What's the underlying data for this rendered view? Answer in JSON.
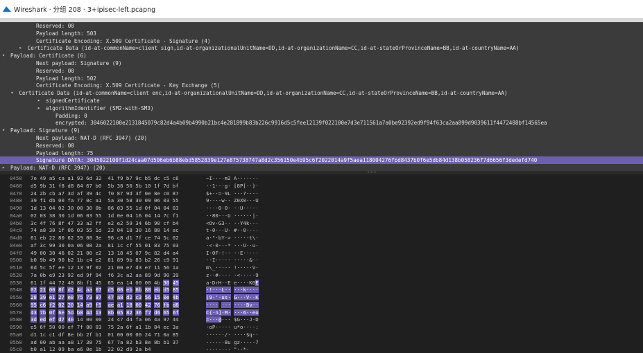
{
  "window": {
    "title": "Wireshark · 分组 208 · 3+ipisec-left.pcapng"
  },
  "detail_lines": [
    {
      "indent": 0,
      "arrow": "",
      "text": "Reserved: 00"
    },
    {
      "indent": 0,
      "arrow": "",
      "text": "Payload length: 503"
    },
    {
      "indent": 0,
      "arrow": "",
      "text": "Certificate Encoding: X.509 Certificate - Signature (4)"
    },
    {
      "indent": -1,
      "arrow": "▸",
      "text": "Certificate Data (id-at-commonName=client sign,id-at-organizationalUnitName=DD,id-at-organizationName=CC,id-at-stateOrProvinceName=BB,id-at-countryName=AA)"
    },
    {
      "indent": -3,
      "arrow": "▾",
      "text": "Payload: Certificate (6)"
    },
    {
      "indent": 0,
      "arrow": "",
      "text": "Next payload: Signature (9)"
    },
    {
      "indent": 0,
      "arrow": "",
      "text": "Reserved: 00"
    },
    {
      "indent": 0,
      "arrow": "",
      "text": "Payload length: 502"
    },
    {
      "indent": 0,
      "arrow": "",
      "text": "Certificate Encoding: X.509 Certificate - Key Exchange (5)"
    },
    {
      "indent": -2,
      "arrow": "▾",
      "text": "Certificate Data (id-at-commonName=client enc,id-at-organizationalUnitName=DD,id-at-organizationName=CC,id-at-stateOrProvinceName=BB,id-at-countryName=AA)"
    },
    {
      "indent": 1,
      "arrow": "▸",
      "text": "signedCertificate"
    },
    {
      "indent": 1,
      "arrow": "▸",
      "text": "algorithmIdentifier (SM2-with-SM3)"
    },
    {
      "indent": 2,
      "arrow": "",
      "text": "Padding: 0"
    },
    {
      "indent": 2,
      "arrow": "",
      "text": "encrypted: 3046022100e2131845079c82d4a4b09b4990b21bc4e281899b83b226c9916d5c5fee12139f022100e7d3e711561a7a0be92392ed9f94f63ca2aa899d9039611f4472488bf14565ea"
    },
    {
      "indent": -3,
      "arrow": "▾",
      "text": "Payload: Signature (9)"
    },
    {
      "indent": 0,
      "arrow": "",
      "text": "Next payload: NAT-D (RFC 3947) (20)"
    },
    {
      "indent": 0,
      "arrow": "",
      "text": "Reserved: 00"
    },
    {
      "indent": 0,
      "arrow": "",
      "text": "Payload length: 75"
    },
    {
      "indent": 0,
      "arrow": "",
      "text": "Signature DATA: 3045022100f1d24caa07d506eb6b88ebd5852839e127e875738747a8d2c356150e4b95c6f2022014a9f5aea118004276fbd8437b0f6e5db84d138b058236f7d6656f3dedefd740",
      "selected": true
    },
    {
      "indent": -3,
      "arrow": "▸",
      "text": "Payload: NAT-D (RFC 3947) (20)"
    }
  ],
  "hex_rows": [
    {
      "offset": "0450",
      "hex": "7e 49 a5 ca a1 93 6d 32  41 f9 b7 9c b5 dc c5 c6",
      "ascii": "~I····m2 A·······"
    },
    {
      "offset": "0460",
      "hex": "d5 9b 31 f8 d8 84 67 b0  5b 38 50 5b 10 1f 7d bf",
      "ascii": "··1···g· [8P[··}·"
    },
    {
      "offset": "0470",
      "hex": "24 2b cb a7 3d af 39 4c  f0 87 9d 3f 0e 8e c0 87",
      "ascii": "$+··=·9L ···?····"
    },
    {
      "offset": "0480",
      "hex": "39 f1 db 00 fa 77 0c a1  5a 30 58 30 09 06 03 55",
      "ascii": "9····w·· Z0X0···U"
    },
    {
      "offset": "0490",
      "hex": "1d 13 04 02 30 00 30 0b  06 03 55 1d 0f 04 04 03",
      "ascii": "····0·0· ··U·····"
    },
    {
      "offset": "04a0",
      "hex": "02 03 38 30 1d 06 03 55  1d 0e 04 16 04 14 7c f1",
      "ascii": "··80···U ······|·"
    },
    {
      "offset": "04b0",
      "hex": "3c 4f 76 8f 47 33 a2 ff  e2 e2 59 34 6b 90 cf b4",
      "ascii": "<Ov·G3·· ··Y4k···"
    },
    {
      "offset": "04c0",
      "hex": "74 a8 30 1f 06 03 55 1d  23 04 18 30 16 80 14 ac",
      "ascii": "t·0···U· #··0····"
    },
    {
      "offset": "04d0",
      "hex": "61 eb 22 80 62 59 08 3e  96 c8 d1 7f ce 74 5c 02",
      "ascii": "a·\"·bY·> ·····t\\·"
    },
    {
      "offset": "04e0",
      "hex": "af 3c 99 30 0a 06 08 2a  81 1c cf 55 01 83 75 03",
      "ascii": "·<·0···* ···U··u·"
    },
    {
      "offset": "04f0",
      "hex": "49 00 30 46 02 21 00 e2  13 18 45 07 9c 82 d4 a4",
      "ascii": "I·0F·!·· ··E·····"
    },
    {
      "offset": "0500",
      "hex": "b0 9b 49 90 b2 1b c4 e2  81 89 9b 83 b2 26 c9 91",
      "ascii": "··I····· ·····&··"
    },
    {
      "offset": "0510",
      "hex": "6d 5c 5f ee 12 13 9f 02  21 00 e7 d3 e7 11 56 1a",
      "ascii": "m\\_····· !·····V·"
    },
    {
      "offset": "0520",
      "hex": "7a 0b e9 23 92 ed 9f 94  f6 3c a2 aa 89 9d 90 39",
      "ascii": "z··#···· ·<·····9"
    },
    {
      "offset": "0530",
      "hex": "61 1f 44 72 48 8b f1 45  65 ea 14 00 00 4b 30 45",
      "ascii": "a·DrH··E e····K0E",
      "hl_hex_start": 14,
      "hl_ascii_start": 15
    },
    {
      "offset": "0540",
      "hex": "02 21 00 8f d2 4c aa 07  d5 06 eb 6b 88 eb d5 85",
      "ascii": "·!···L·· ···k····",
      "hl_all": true
    },
    {
      "offset": "0550",
      "hex": "28 39 e1 27 e8 75 73 87  47 a8 d2 c3 56 15 0e 4b",
      "ascii": "(9·'·us· G···V··K",
      "hl_all": true
    },
    {
      "offset": "0560",
      "hex": "95 c6 f2 02 20 14 a9 f5  ae a1 18 00 42 76 fb d8",
      "ascii": "···· ··· ····Bv··",
      "hl_all": true
    },
    {
      "offset": "0570",
      "hex": "43 7b 0f 6e 5d b8 4d 13  8b 05 82 36 f7 d6 65 6f",
      "ascii": "C{·n]·M· ···6··eo",
      "hl_all": true
    },
    {
      "offset": "0580",
      "hex": "3d ed ef d7 40 14 00 00  24 47 d4 fa 06 4a 97 44",
      "ascii": "=···@··· $G···J·D",
      "hl_hex_end": 5,
      "hl_ascii_end": 5
    },
    {
      "offset": "0590",
      "hex": "e5 6f 50 00 ef 7f 80 03  75 2a 6f a1 1b 84 ec 3a",
      "ascii": "·oP····· u*o····:"
    },
    {
      "offset": "05a0",
      "hex": "d1 1c c1 df 8e bb 2f b1  01 00 00 00 24 71 0a 85",
      "ascii": "······/· ····$q··"
    },
    {
      "offset": "05b0",
      "hex": "ad 00 ab aa a8 17 38 75  67 7a 82 b3 8e 8b b1 37",
      "ascii": "······8u gz·····7"
    },
    {
      "offset": "05c0",
      "hex": "b0 a1 12 09 ba e6 0e 1b  22 02 d9 2a b4",
      "ascii": "········ \"··*·"
    }
  ]
}
